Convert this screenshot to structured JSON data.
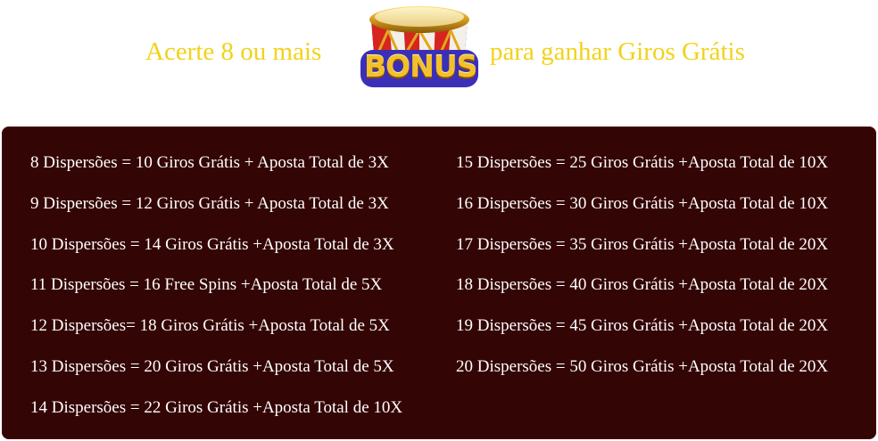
{
  "header": {
    "text_before": "Acerte 8 ou mais",
    "text_after": "para ganhar Giros Grátis",
    "icon": "bonus-drum-icon",
    "icon_label": "BONUS",
    "accent_color": "#f2d21a"
  },
  "panel": {
    "background_color": "#340505",
    "left_rows": [
      "8 Dispersões = 10 Giros Grátis + Aposta Total de 3X",
      "9 Dispersões = 12 Giros Grátis + Aposta Total de 3X",
      "10 Dispersões = 14 Giros Grátis +Aposta Total de 3X",
      "11 Dispersões = 16 Free Spins +Aposta Total de 5X",
      "12 Dispersões= 18 Giros Grátis +Aposta Total de 5X",
      "13 Dispersões = 20 Giros Grátis +Aposta Total de 5X",
      "14 Dispersões = 22 Giros Grátis +Aposta Total de 10X"
    ],
    "right_rows": [
      "15 Dispersões = 25 Giros Grátis +Aposta Total de 10X",
      "16 Dispersões = 30 Giros Grátis +Aposta Total de 10X",
      "17 Dispersões = 35 Giros Grátis +Aposta Total de 20X",
      "18 Dispersões = 40 Giros Grátis +Aposta Total de 20X",
      "19 Dispersões = 45 Giros Grátis +Aposta Total de 20X",
      "20 Dispersões = 50 Giros Grátis +Aposta Total de 20X"
    ]
  }
}
